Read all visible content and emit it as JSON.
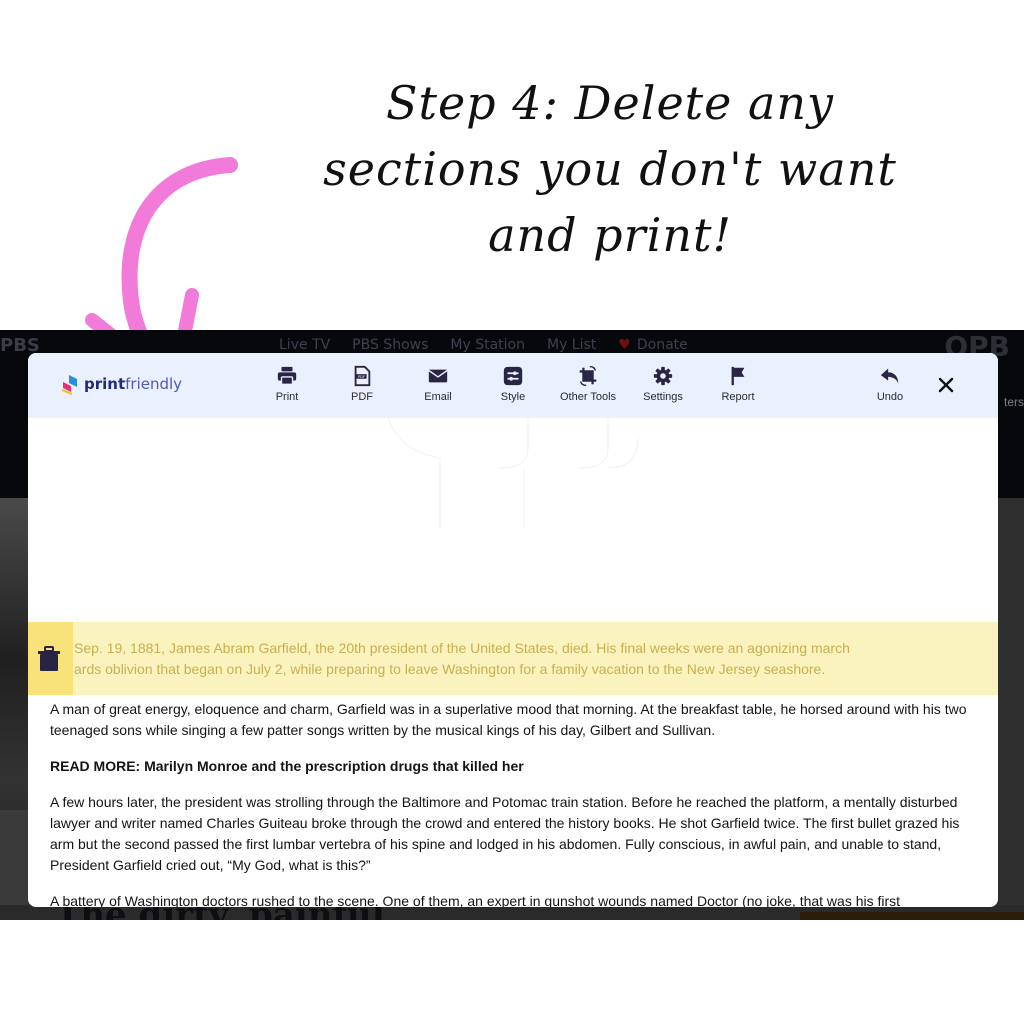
{
  "heading": {
    "lines": [
      "Step 4: Delete any",
      "sections you don't want",
      "and print!"
    ]
  },
  "colors": {
    "arrow": "#f27ad8",
    "toolbar_bg": "#eaf0fd",
    "icon": "#2a2545",
    "highlight_bg": "#fbf3bd",
    "trash_bg": "#f8e37a",
    "highlight_text": "#c9ae52"
  },
  "background_site": {
    "logo": "PBS",
    "nav": [
      "Live TV",
      "PBS Shows",
      "My Station",
      "My List",
      "Donate"
    ],
    "station_logo": "OPB",
    "side_text": "ters",
    "article_title_fragment": "The dirty, painful"
  },
  "printfriendly": {
    "brand_bold": "print",
    "brand_light": "friendly",
    "toolbar": [
      {
        "id": "print",
        "label": "Print",
        "icon": "printer-icon"
      },
      {
        "id": "pdf",
        "label": "PDF",
        "icon": "pdf-file-icon"
      },
      {
        "id": "email",
        "label": "Email",
        "icon": "envelope-icon"
      },
      {
        "id": "style",
        "label": "Style",
        "icon": "sliders-icon"
      },
      {
        "id": "other-tools",
        "label": "Other Tools",
        "icon": "crop-rotate-icon"
      },
      {
        "id": "settings",
        "label": "Settings",
        "icon": "gear-icon"
      },
      {
        "id": "report",
        "label": "Report",
        "icon": "flag-icon"
      },
      {
        "id": "undo",
        "label": "Undo",
        "icon": "undo-arrow-icon"
      }
    ],
    "close_icon": "close-icon"
  },
  "article": {
    "highlighted_lines": [
      "Sep. 19, 1881, James Abram Garfield, the 20th president of the United States, died. His final weeks were an agonizing march",
      "ards oblivion that began on July 2, while preparing to leave Washington for a family vacation to the New Jersey seashore."
    ],
    "paragraphs": [
      {
        "text": "A man of great energy, eloquence and charm, Garfield was in a superlative mood that morning. At the breakfast table, he horsed around with his two teenaged sons while singing a few patter songs written by the musical kings of his day, Gilbert and Sullivan.",
        "bold": false
      },
      {
        "text": "READ MORE: Marilyn Monroe and the prescription drugs that killed her",
        "bold": true
      },
      {
        "text": "A few hours later, the president was strolling through the Baltimore and Potomac train station. Before he reached the platform, a mentally disturbed lawyer and writer named Charles Guiteau broke through the crowd and entered the history books. He shot Garfield twice. The first bullet grazed his arm but the second passed the first lumbar vertebra of his spine and lodged in his abdomen. Fully conscious, in awful pain, and unable to stand, President Garfield cried out, “My God, what is this?”",
        "bold": false
      },
      {
        "text": "A battery of Washington doctors rushed to the scene. One of them, an expert in gunshot wounds named Doctor (no joke, that was his first",
        "bold": false
      }
    ]
  }
}
